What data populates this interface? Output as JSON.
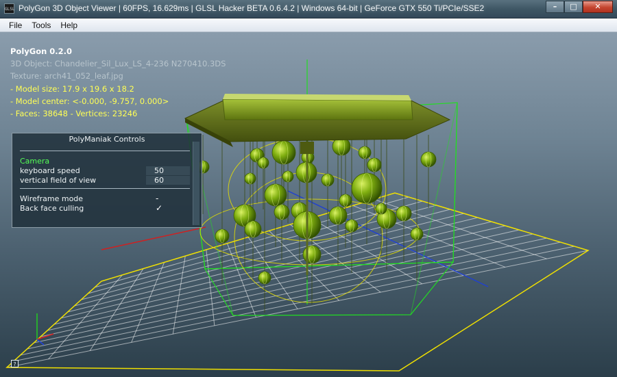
{
  "window": {
    "title": "PolyGon 3D Object Viewer | 60FPS, 16.629ms | GLSL Hacker BETA 0.6.4.2 | Windows 64-bit | GeForce GTX 550 Ti/PCIe/SSE2",
    "icon_label": "GLSL",
    "minimize_label": "–",
    "maximize_label": "□",
    "close_label": "✕"
  },
  "menu": {
    "items": [
      {
        "label": "File"
      },
      {
        "label": "Tools"
      },
      {
        "label": "Help"
      }
    ]
  },
  "info": {
    "app_name": "PolyGon 0.2.0",
    "object": "3D Object: Chandelier_Sil_Lux_LS_4-236 N270410.3DS",
    "texture": "Texture: arch41_052_leaf.jpg",
    "model_size": "- Model size:  17.9 x 19.6 x 18.2",
    "model_center": "- Model center:  <-0.000, -9.757, 0.000>",
    "faces_vertices": "- Faces: 38648 - Vertices: 23246"
  },
  "controls": {
    "title": "PolyManiak Controls",
    "section_camera": "Camera",
    "keyboard_speed_label": "keyboard speed",
    "keyboard_speed_value": "50",
    "fov_label": "vertical field of view",
    "fov_value": "60",
    "wireframe_label": "Wireframe mode",
    "wireframe_value": "-",
    "backface_label": "Back face culling",
    "backface_value": "✓"
  },
  "help_icon_label": "?",
  "colors": {
    "info_yellow": "#ffff55",
    "camera_green": "#55ff55",
    "bbox_green": "#22dd22",
    "object_green": "#6fa800",
    "gizmo_red": "#dd2222",
    "gizmo_blue": "#2244dd"
  }
}
